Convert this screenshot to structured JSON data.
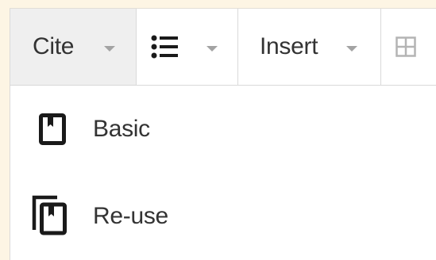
{
  "toolbar": {
    "cite_label": "Cite",
    "list_icon": "bulleted-list-icon",
    "insert_label": "Insert",
    "table_icon": "table-icon",
    "caret_icon": "chevron-down-icon"
  },
  "cite_menu": {
    "items": [
      {
        "label": "Basic",
        "icon": "bookmark-document-icon"
      },
      {
        "label": "Re-use",
        "icon": "stacked-bookmark-documents-icon"
      }
    ]
  },
  "colors": {
    "page_background": "#fdf5e4",
    "active_button_background": "#efefef",
    "text": "#333333",
    "icon_dark": "#1a1a1a",
    "caret": "#a3a3a3"
  }
}
